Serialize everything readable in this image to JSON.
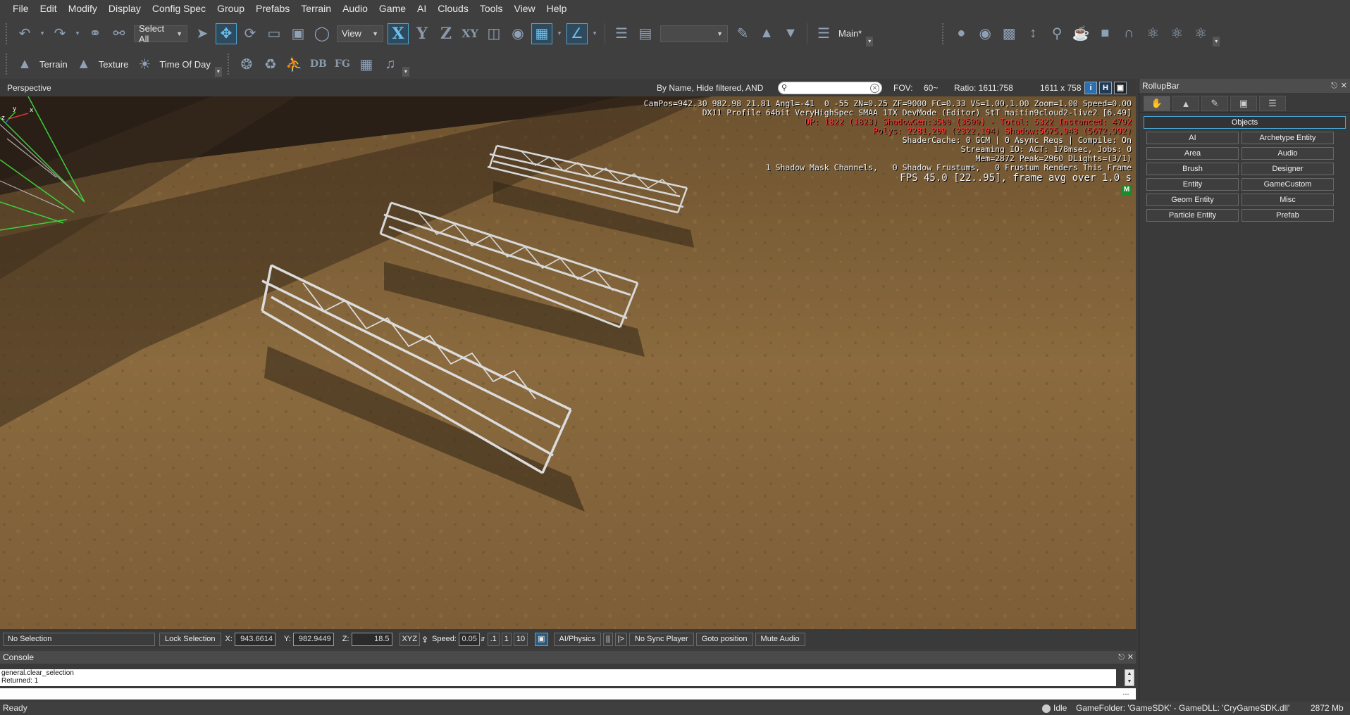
{
  "menu": [
    "File",
    "Edit",
    "Modify",
    "Display",
    "Config Spec",
    "Group",
    "Prefabs",
    "Terrain",
    "Audio",
    "Game",
    "AI",
    "Clouds",
    "Tools",
    "View",
    "Help"
  ],
  "toolbar1": {
    "select_all": "Select All",
    "view": "View",
    "axis_x": "X",
    "axis_y": "Y",
    "axis_z": "Z",
    "axis_xy": "XY",
    "layer": "Main*"
  },
  "toolbar2": {
    "terrain": "Terrain",
    "texture": "Texture",
    "time_of_day": "Time Of Day",
    "db": "DB",
    "fg": "FG"
  },
  "viewport": {
    "title": "Perspective",
    "filter": "By Name, Hide filtered, AND",
    "search_placeholder": "",
    "fov_label": "FOV:",
    "fov_value": "60~",
    "ratio_label": "Ratio: 1611:758",
    "resolution": "1611 x 758",
    "btn_info": "i",
    "btn_h": "H"
  },
  "debug": {
    "line1": "CamPos=942.30 982.98 21.81 Angl=-41  0 -55 ZN=0.25 ZF=9000 FC=0.33 VS=1.00,1.00 Zoom=1.00 Speed=0.00",
    "line2": "DX11 Profile 64bit VeryHighSpec SMAA 1TX DevMode (Editor) StT maitin9cloud2-live2 [6.49]",
    "line3": "DP: 1822 (1823) ShadowGen:3500 (3500) - Total: 5322 Instanced: 4792",
    "line4": "Polys: 2281,209 (2322,104) Shadow:5675,943 (5672,992)",
    "line5": "ShaderCache: 0 GCM | 0 Async Reqs | Compile: On",
    "line6": "Streaming IO: ACT: 178msec, Jobs: 0",
    "line7": "Mem=2872 Peak=2960 DLights=(3/1)",
    "line8": "1 Shadow Mask Channels,   0 Shadow Frustums,   0 Frustum Renders This Frame",
    "line9": "FPS 45.0 [22..95], frame avg over 1.0 s",
    "badge": "M"
  },
  "rollup": {
    "title": "RollupBar",
    "section": "Objects",
    "buttons": [
      "AI",
      "Archetype Entity",
      "Area",
      "Audio",
      "Brush",
      "Designer",
      "Entity",
      "GameCustom",
      "Geom Entity",
      "Misc",
      "Particle Entity",
      "Prefab"
    ]
  },
  "statusbar": {
    "selection": "No Selection",
    "lock": "Lock Selection",
    "x_label": "X:",
    "x_value": "943.6614",
    "y_label": "Y:",
    "y_value": "982.9449",
    "z_label": "Z:",
    "z_value": "18.5",
    "xyz": "XYZ",
    "speed_label": "Speed:",
    "speed_value": "0.05",
    "speed_01": ".1",
    "speed_1": "1",
    "speed_10": "10",
    "ai_physics": "AI/Physics",
    "pause": "||",
    "step": "|>",
    "sync": "No Sync Player",
    "goto": "Goto position",
    "mute": "Mute Audio"
  },
  "console": {
    "title": "Console",
    "line1": "general.clear_selection",
    "line2": "Returned: 1",
    "more": "..."
  },
  "status": {
    "ready": "Ready",
    "idle": "Idle",
    "gamefolder": "GameFolder: 'GameSDK' - GameDLL: 'CryGameSDK.dll'",
    "mem": "2872 Mb"
  },
  "colors": {
    "accent": "#4aa7d8",
    "ground": "#7a5c36",
    "debug_red": "#ff3b3b"
  }
}
